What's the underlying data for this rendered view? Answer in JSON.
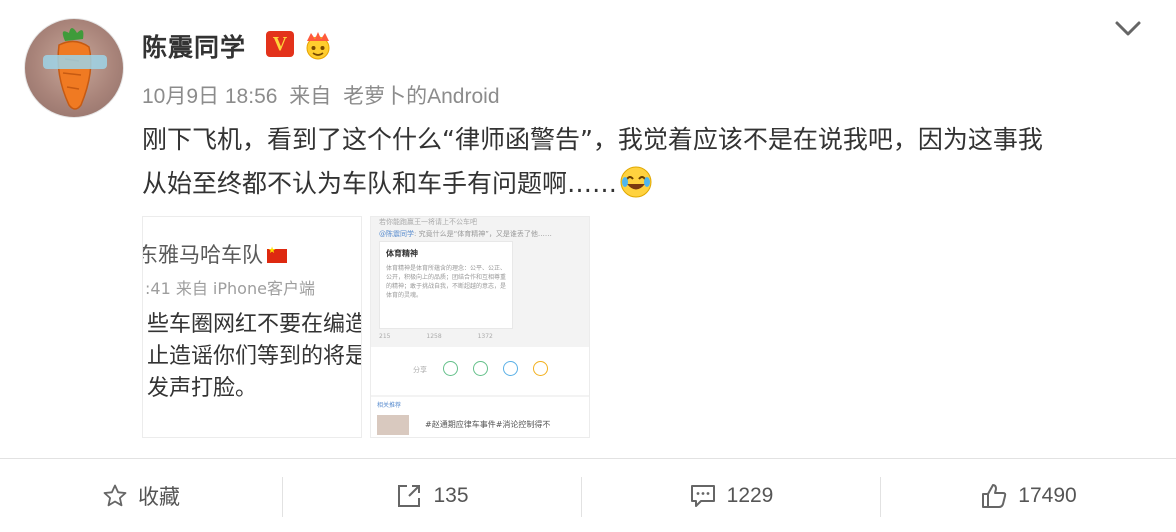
{
  "post": {
    "username": "陈震同学",
    "verified_badge": "V",
    "date": "10月9日 18:56",
    "source_prefix": "来自",
    "source": "老萝卜的Android",
    "text_line1": "刚下飞机，看到了这个什么“律师函警告”，我觉着应该不是在说我吧，因为这事我",
    "text_line2": "从始至终都不认为车队和车手有问题啊……",
    "emoji": "laugh-cry-emoji"
  },
  "thumbnail1": {
    "title": "东雅马哈车队",
    "meta_time": ":41",
    "meta_source": "来自 iPhone客户端",
    "line1": "些车圈网红不要在编造",
    "line2": "止造谣你们等到的将是",
    "line3": "发声打脸。"
  },
  "thumbnail2": {
    "top_text": "若你能跑赢王一将请上不公车吧",
    "user_line_name": "@陈震同学",
    "user_line_text": ": 究竟什么是“体育精神”，又是谁丢了他……",
    "card_title": "体育精神",
    "card_body": "体育精神是体育所蕴含的理念：公平、公正、公开，积极向上的品质；团结合作和互相尊重的精神；敢于挑战自我，不断超越的意志，是体育的灵魂。",
    "stat_repost": "215",
    "stat_comment": "1258",
    "stat_like": "1372",
    "share_label": "分享",
    "related_label": "相关推荐",
    "related_text": "#赵通期应律车事件#消论控制得不"
  },
  "actions": {
    "favorite": "收藏",
    "repost_count": "135",
    "comment_count": "1229",
    "like_count": "17490"
  },
  "colors": {
    "text": "#333333",
    "meta": "#8c8c8c",
    "verified_red": "#e3321b",
    "verified_gold": "#ffd43a"
  }
}
